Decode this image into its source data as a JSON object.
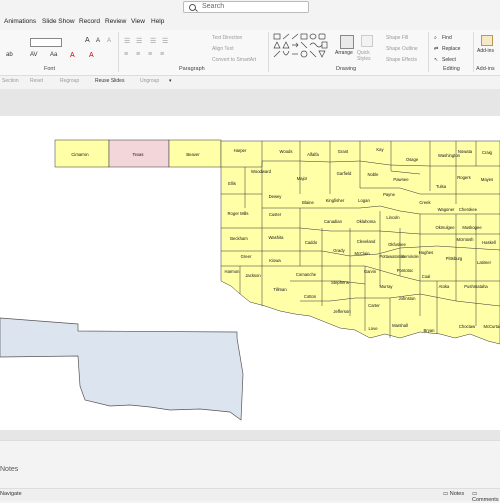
{
  "search": {
    "placeholder": "Search"
  },
  "tabs": [
    "Animations",
    "Slide Show",
    "Record",
    "Review",
    "View",
    "Help"
  ],
  "ribbon": {
    "font_group": "Font",
    "paragraph_group": "Paragraph",
    "drawing_group": "Drawing",
    "editing_group": "Editing",
    "addins_group": "Add-ins",
    "text_direction": "Text Direction",
    "align_text": "Align Text",
    "convert_smartart": "Convert to SmartArt",
    "arrange": "Arrange",
    "quick_styles": "Quick Styles",
    "shape_fill": "Shape Fill",
    "shape_outline": "Shape Outline",
    "shape_effects": "Shape Effects",
    "find": "Find",
    "replace": "Replace",
    "select": "Select",
    "addins": "Add-ins"
  },
  "quick_access": {
    "section": "Section",
    "reset": "Reset",
    "reuse_slides": "Reuse Slides",
    "regroup": "Regroup",
    "ungroup": "Ungroup"
  },
  "counties": {
    "panhandle": [
      "Cimarron",
      "Texas",
      "Beaver"
    ],
    "names": [
      "Harper",
      "Woods",
      "Alfalfa",
      "Grant",
      "Kay",
      "Osage",
      "Washington",
      "Nowata",
      "Craig",
      "Ellis",
      "Woodward",
      "Major",
      "Garfield",
      "Noble",
      "Pawnee",
      "Tulsa",
      "Rogers",
      "Mayes",
      "Dewey",
      "Blaine",
      "Kingfisher",
      "Logan",
      "Payne",
      "Creek",
      "Wagoner",
      "Cherokee",
      "Roger Mills",
      "Custer",
      "Canadian",
      "Oklahoma",
      "Lincoln",
      "Okmulgee",
      "Muskogee",
      "Beckham",
      "Washita",
      "Caddo",
      "Cleveland",
      "Okfuskee",
      "McIntosh",
      "Grady",
      "McClain",
      "Pottawatomie",
      "Seminole",
      "Hughes",
      "Haskell",
      "Greer",
      "Kiowa",
      "Pittsburg",
      "Latimer",
      "Harmon",
      "Jackson",
      "Comanche",
      "Garvin",
      "Pontotoc",
      "Coal",
      "Tillman",
      "Cotton",
      "Stephens",
      "Murray",
      "Atoka",
      "Pushmataha",
      "Jefferson",
      "Carter",
      "Johnston",
      "Love",
      "Marshall",
      "Bryan",
      "Choctaw",
      "McCurtain"
    ]
  },
  "notes": {
    "label": "Notes"
  },
  "status": {
    "left": "Navigate",
    "notes": "Notes",
    "comments": "Comments"
  }
}
